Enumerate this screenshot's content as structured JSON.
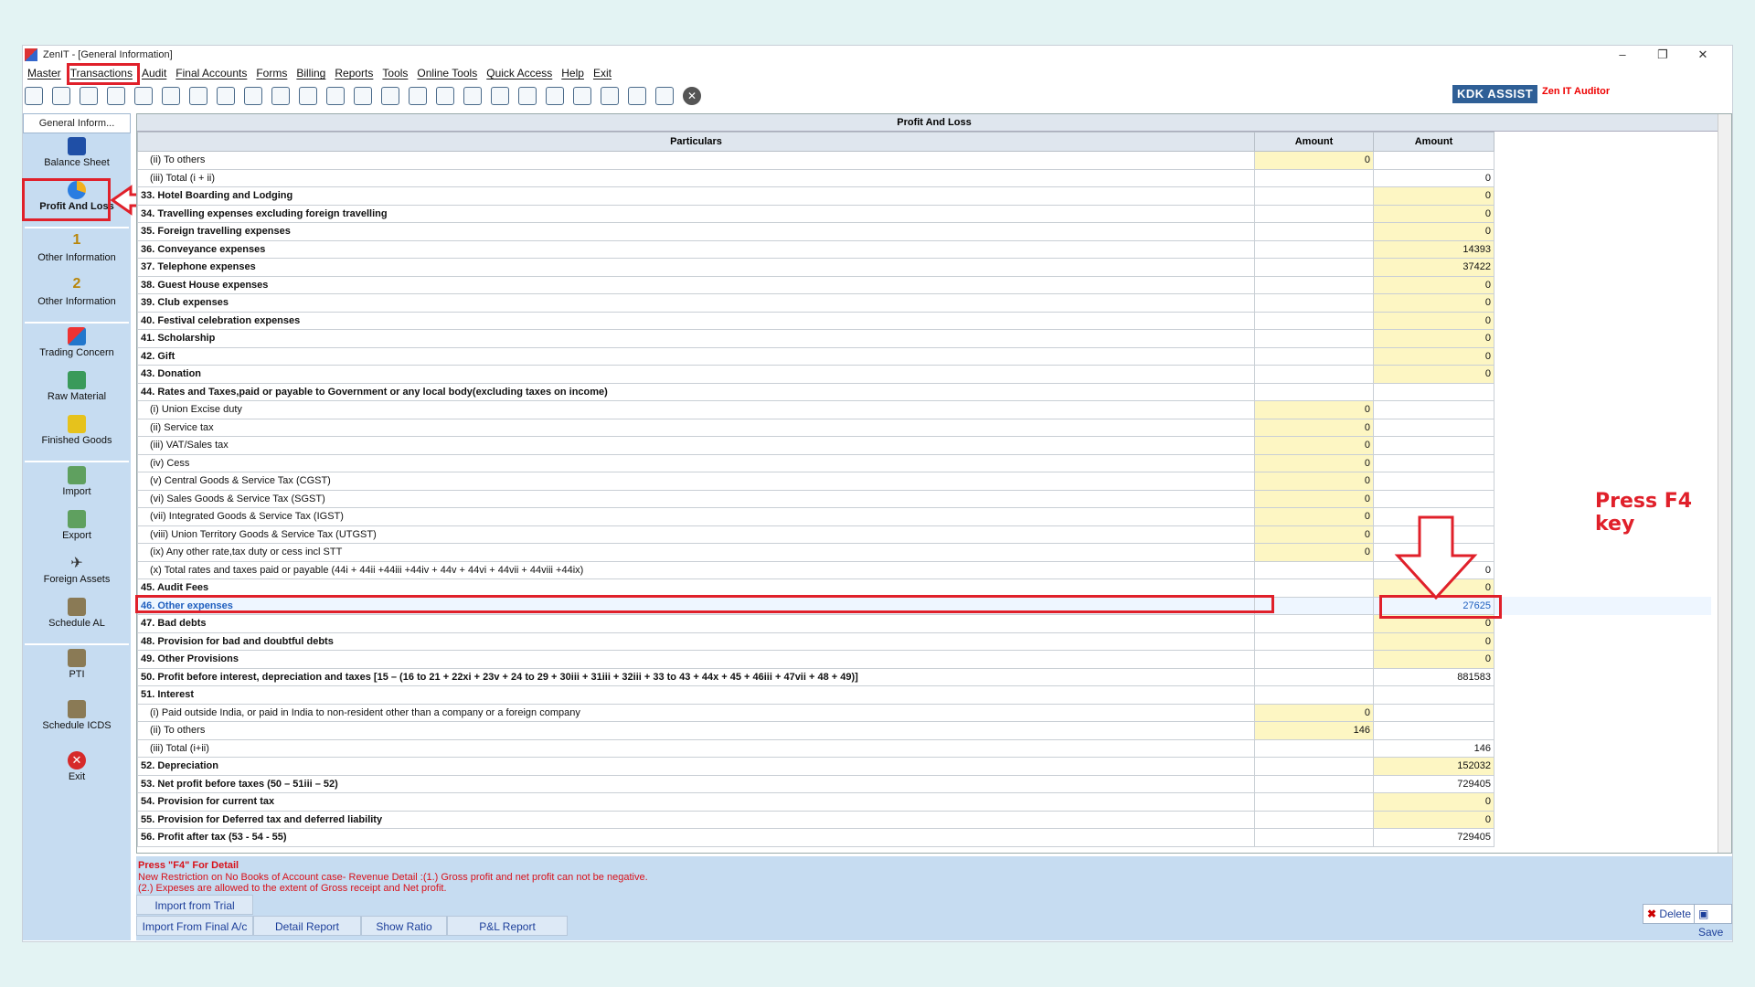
{
  "window": {
    "title": "ZenIT - [General Information]",
    "min": "–",
    "restore": "❐",
    "close": "✕"
  },
  "menu": [
    "Master",
    "Transactions",
    "Audit",
    "Final Accounts",
    "Forms",
    "Billing",
    "Reports",
    "Tools",
    "Online Tools",
    "Quick Access",
    "Help",
    "Exit"
  ],
  "brand": {
    "kdk": "KDK ASSIST",
    "zen": "Zen IT Auditor"
  },
  "sidebar": {
    "header": "General Inform...",
    "items": [
      {
        "label": "Balance Sheet",
        "icon": "balance-sheet-icon"
      },
      {
        "label": "Profit And Loss",
        "icon": "pie-chart-icon"
      },
      {
        "label": "Other Information",
        "icon": "number-one-icon"
      },
      {
        "label": "Other Information",
        "icon": "number-two-icon"
      },
      {
        "label": "Trading Concern",
        "icon": "trading-concern-icon"
      },
      {
        "label": "Raw Material",
        "icon": "raw-material-icon"
      },
      {
        "label": "Finished Goods",
        "icon": "finished-goods-icon"
      },
      {
        "label": "Import",
        "icon": "import-icon"
      },
      {
        "label": "Export",
        "icon": "export-icon"
      },
      {
        "label": "Foreign Assets",
        "icon": "plane-icon"
      },
      {
        "label": "Schedule AL",
        "icon": "schedule-al-icon"
      },
      {
        "label": "PTI",
        "icon": "pti-icon"
      },
      {
        "label": "Schedule ICDS",
        "icon": "schedule-icds-icon"
      },
      {
        "label": "Exit",
        "icon": "exit-icon"
      }
    ]
  },
  "table": {
    "title": "Profit And Loss",
    "headers": [
      "Particulars",
      "Amount",
      "Amount"
    ],
    "rows": [
      {
        "p": "(ii) To others",
        "a1": "0",
        "a2": ""
      },
      {
        "p": "(iii) Total (i + ii)",
        "a1": "",
        "a2": "0"
      },
      {
        "p": "33. Hotel Boarding and Lodging",
        "a1": "",
        "a2": "0"
      },
      {
        "p": "34. Travelling expenses excluding foreign travelling",
        "a1": "",
        "a2": "0"
      },
      {
        "p": "35. Foreign travelling expenses",
        "a1": "",
        "a2": "0"
      },
      {
        "p": "36. Conveyance expenses",
        "a1": "",
        "a2": "14393"
      },
      {
        "p": "37. Telephone expenses",
        "a1": "",
        "a2": "37422"
      },
      {
        "p": "38. Guest House expenses",
        "a1": "",
        "a2": "0"
      },
      {
        "p": "39. Club expenses",
        "a1": "",
        "a2": "0"
      },
      {
        "p": "40. Festival celebration expenses",
        "a1": "",
        "a2": "0"
      },
      {
        "p": "41. Scholarship",
        "a1": "",
        "a2": "0"
      },
      {
        "p": "42. Gift",
        "a1": "",
        "a2": "0"
      },
      {
        "p": "43. Donation",
        "a1": "",
        "a2": "0"
      },
      {
        "p": "44.  Rates and Taxes,paid or payable to Government or any local body(excluding taxes on income)",
        "a1": "",
        "a2": ""
      },
      {
        "p": "(i) Union Excise duty",
        "a1": "0",
        "a2": ""
      },
      {
        "p": "(ii) Service tax",
        "a1": "0",
        "a2": ""
      },
      {
        "p": "(iii)  VAT/Sales tax",
        "a1": "0",
        "a2": ""
      },
      {
        "p": "(iv) Cess",
        "a1": "0",
        "a2": ""
      },
      {
        "p": "(v) Central Goods & Service Tax (CGST)",
        "a1": "0",
        "a2": ""
      },
      {
        "p": "(vi) Sales Goods & Service Tax (SGST)",
        "a1": "0",
        "a2": ""
      },
      {
        "p": "(vii) Integrated Goods & Service Tax (IGST)",
        "a1": "0",
        "a2": ""
      },
      {
        "p": "(viii) Union Territory Goods & Service Tax (UTGST)",
        "a1": "0",
        "a2": ""
      },
      {
        "p": "(ix)  Any other rate,tax duty or cess incl STT",
        "a1": "0",
        "a2": ""
      },
      {
        "p": "(x) Total rates and taxes paid or payable (44i + 44ii +44iii +44iv + 44v + 44vi + 44vii + 44viii +44ix)",
        "a1": "",
        "a2": "0"
      },
      {
        "p": "45. Audit Fees",
        "a1": "",
        "a2": "0"
      },
      {
        "p": "46. Other expenses",
        "a1": "",
        "a2": "27625"
      },
      {
        "p": "47. Bad debts",
        "a1": "",
        "a2": "0"
      },
      {
        "p": "48. Provision for bad and doubtful debts",
        "a1": "",
        "a2": "0"
      },
      {
        "p": "49. Other Provisions",
        "a1": "",
        "a2": "0"
      },
      {
        "p": "50. Profit before interest, depreciation and taxes [15 – (16 to 21 + 22xi + 23v + 24 to 29 + 30iii + 31iii + 32iii + 33 to 43 + 44x + 45 + 46iii + 47vii + 48 + 49)]",
        "a1": "",
        "a2": "881583"
      },
      {
        "p": "51. Interest",
        "a1": "",
        "a2": ""
      },
      {
        "p": "(i) Paid outside India, or paid in India to non-resident other than a company or a foreign company",
        "a1": "0",
        "a2": ""
      },
      {
        "p": "(ii) To others",
        "a1": "146",
        "a2": ""
      },
      {
        "p": "(iii) Total (i+ii)",
        "a1": "",
        "a2": "146"
      },
      {
        "p": "52. Depreciation",
        "a1": "",
        "a2": "152032"
      },
      {
        "p": "53. Net profit before taxes (50 – 51iii – 52)",
        "a1": "",
        "a2": "729405"
      },
      {
        "p": "54. Provision for current tax",
        "a1": "",
        "a2": "0"
      },
      {
        "p": "55. Provision for Deferred tax  and deferred liability",
        "a1": "",
        "a2": "0"
      },
      {
        "p": "56. Profit after tax (53 - 54 - 55)",
        "a1": "",
        "a2": "729405"
      }
    ]
  },
  "footer": {
    "hint": "Press \"F4\" For Detail",
    "restriction1": "New  Restriction on No Books of Account case- Revenue Detail :(1.) Gross profit and net profit can not be negative.",
    "restriction2": "(2.) Expeses are allowed to the extent of Gross receipt and Net profit.",
    "tabs": [
      "Import from Trial Balance",
      "Import From Final A/c",
      "Detail Report",
      "Show Ratio",
      "P&L Report"
    ],
    "delete": "Delete",
    "save": "Save"
  },
  "annotation": {
    "text": "Press F4 key"
  },
  "colors": {
    "highlight": "#e0202a",
    "editable_cell": "#fdf6c3",
    "sidebar": "#c6dcf1",
    "selected_text": "#1f5fbf"
  }
}
